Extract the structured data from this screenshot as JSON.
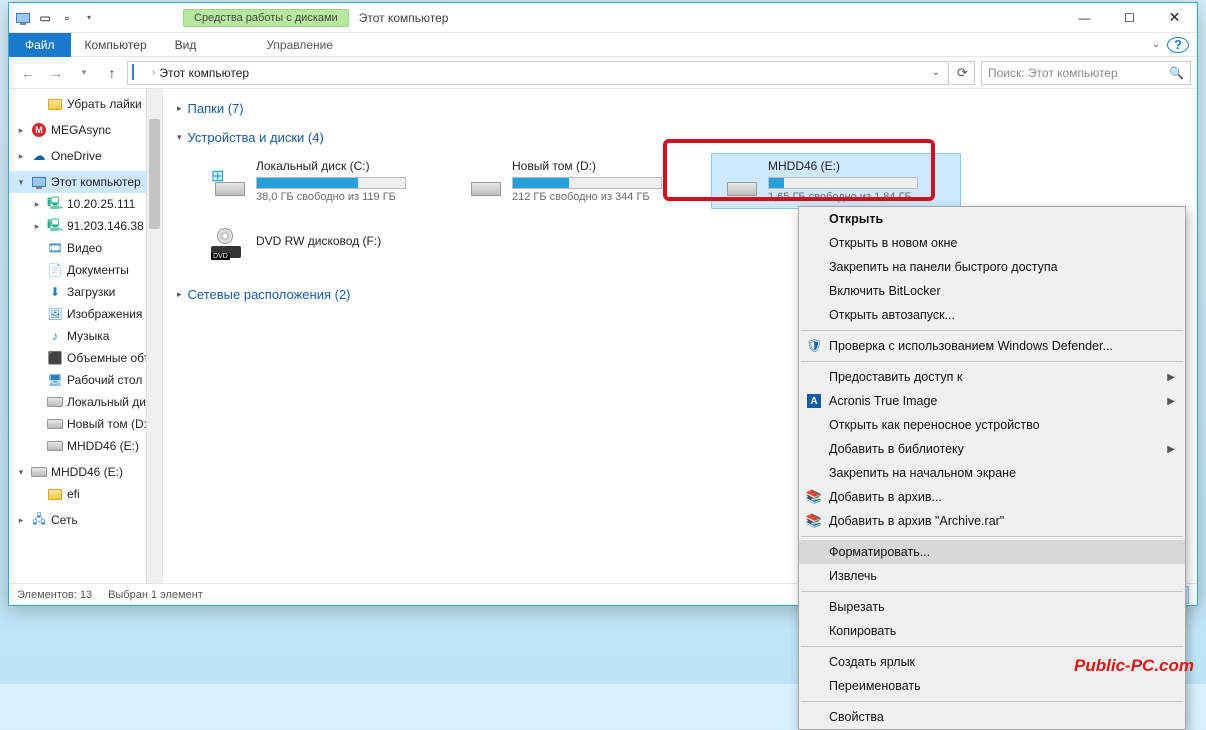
{
  "titlebar": {
    "tool_tab": "Средства работы с дисками",
    "title": "Этот компьютер"
  },
  "ribbon": {
    "file": "Файл",
    "tabs": [
      "Компьютер",
      "Вид"
    ],
    "tool_sub": "Управление"
  },
  "address": {
    "crumb": "Этот компьютер",
    "search_placeholder": "Поиск: Этот компьютер"
  },
  "nav": {
    "items": [
      {
        "indent": "sub",
        "twist": "",
        "icon": "folder",
        "label": "Убрать лайки Вк"
      },
      {
        "indent": "",
        "twist": ">",
        "icon": "mega",
        "label": "MEGAsync",
        "sp": true
      },
      {
        "indent": "",
        "twist": ">",
        "icon": "od",
        "label": "OneDrive",
        "sp": true
      },
      {
        "indent": "",
        "twist": "v",
        "icon": "pc",
        "label": "Этот компьютер",
        "sel": true,
        "sp": true
      },
      {
        "indent": "sub",
        "twist": ">",
        "icon": "net",
        "label": "10.20.25.111"
      },
      {
        "indent": "sub",
        "twist": ">",
        "icon": "net",
        "label": "91.203.146.38"
      },
      {
        "indent": "sub",
        "twist": "",
        "icon": "vid",
        "label": "Видео"
      },
      {
        "indent": "sub",
        "twist": "",
        "icon": "doc",
        "label": "Документы"
      },
      {
        "indent": "sub",
        "twist": "",
        "icon": "dl",
        "label": "Загрузки"
      },
      {
        "indent": "sub",
        "twist": "",
        "icon": "img",
        "label": "Изображения"
      },
      {
        "indent": "sub",
        "twist": "",
        "icon": "mus",
        "label": "Музыка"
      },
      {
        "indent": "sub",
        "twist": "",
        "icon": "obj",
        "label": "Объемные объ"
      },
      {
        "indent": "sub",
        "twist": "",
        "icon": "desk",
        "label": "Рабочий стол"
      },
      {
        "indent": "sub",
        "twist": "",
        "icon": "hdd",
        "label": "Локальный дис"
      },
      {
        "indent": "sub",
        "twist": "",
        "icon": "hdd",
        "label": "Новый том (D:)"
      },
      {
        "indent": "sub",
        "twist": "",
        "icon": "hdd",
        "label": "MHDD46 (E:)"
      },
      {
        "indent": "",
        "twist": "v",
        "icon": "hdd",
        "label": "MHDD46 (E:)",
        "sp": true
      },
      {
        "indent": "sub",
        "twist": "",
        "icon": "folder",
        "label": "efi"
      },
      {
        "indent": "",
        "twist": ">",
        "icon": "netw",
        "label": "Сеть",
        "sp": true
      }
    ]
  },
  "sections": {
    "folders": "Папки (7)",
    "drives": "Устройства и диски (4)",
    "network": "Сетевые расположения (2)"
  },
  "drives": [
    {
      "name": "Локальный диск (C:)",
      "fill": 68,
      "sub": "38,0 ГБ свободно из 119 ГБ",
      "icon": "win"
    },
    {
      "name": "Новый том (D:)",
      "fill": 38,
      "sub": "212 ГБ свободно из 344 ГБ",
      "icon": "hdd"
    },
    {
      "name": "MHDD46 (E:)",
      "fill": 10,
      "sub": "1,65 ГБ свободно из 1,84 ГБ",
      "icon": "hdd",
      "sel": true
    },
    {
      "name": "DVD RW дисковод (F:)",
      "fill": -1,
      "sub": "",
      "icon": "dvd"
    }
  ],
  "status": {
    "count": "Элементов: 13",
    "sel": "Выбран 1 элемент"
  },
  "ctx": {
    "items": [
      {
        "t": "Открыть",
        "bold": true
      },
      {
        "t": "Открыть в новом окне"
      },
      {
        "t": "Закрепить на панели быстрого доступа"
      },
      {
        "t": "Включить BitLocker"
      },
      {
        "t": "Открыть автозапуск..."
      },
      {
        "sep": true
      },
      {
        "t": "Проверка с использованием Windows Defender...",
        "icon": "shield"
      },
      {
        "sep": true
      },
      {
        "t": "Предоставить доступ к",
        "arr": true
      },
      {
        "t": "Acronis True Image",
        "icon": "acr",
        "arr": true
      },
      {
        "t": "Открыть как переносное устройство"
      },
      {
        "t": "Добавить в библиотеку",
        "arr": true
      },
      {
        "t": "Закрепить на начальном экране"
      },
      {
        "t": "Добавить в архив...",
        "icon": "rar"
      },
      {
        "t": "Добавить в архив \"Archive.rar\"",
        "icon": "rar"
      },
      {
        "sep": true
      },
      {
        "t": "Форматировать...",
        "hover": true
      },
      {
        "t": "Извлечь"
      },
      {
        "sep": true
      },
      {
        "t": "Вырезать"
      },
      {
        "t": "Копировать"
      },
      {
        "sep": true
      },
      {
        "t": "Создать ярлык"
      },
      {
        "t": "Переименовать"
      },
      {
        "sep": true
      },
      {
        "t": "Свойства"
      }
    ]
  },
  "watermark": "Public-PC.com"
}
